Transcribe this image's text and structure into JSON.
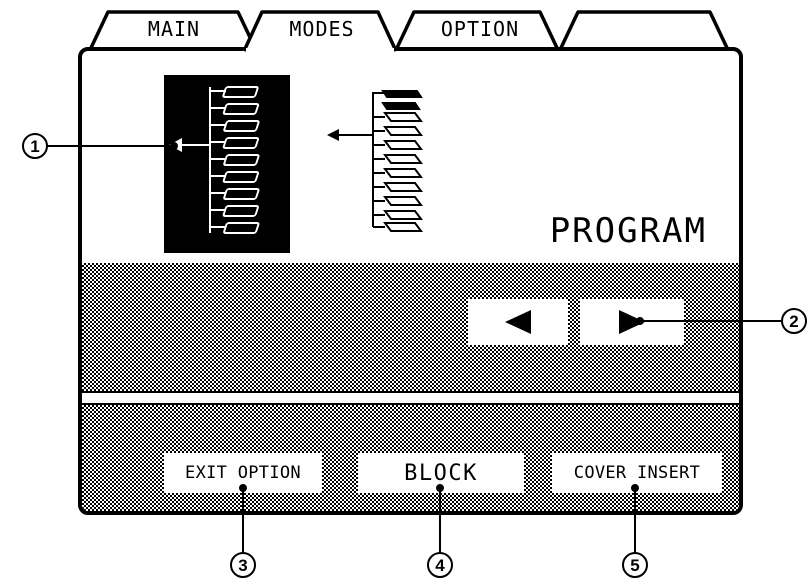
{
  "tabs": [
    {
      "label": "MAIN"
    },
    {
      "label": "MODES"
    },
    {
      "label": "OPTION"
    },
    {
      "label": ""
    }
  ],
  "mode_label": "PROGRAM",
  "nav": {
    "prev_icon": "left-triangle-icon",
    "next_icon": "right-triangle-icon"
  },
  "buttons": {
    "exit_option": "EXIT OPTION",
    "block": "BLOCK",
    "cover_insert": "COVER INSERT"
  },
  "callouts": [
    "1",
    "2",
    "3",
    "4",
    "5"
  ]
}
